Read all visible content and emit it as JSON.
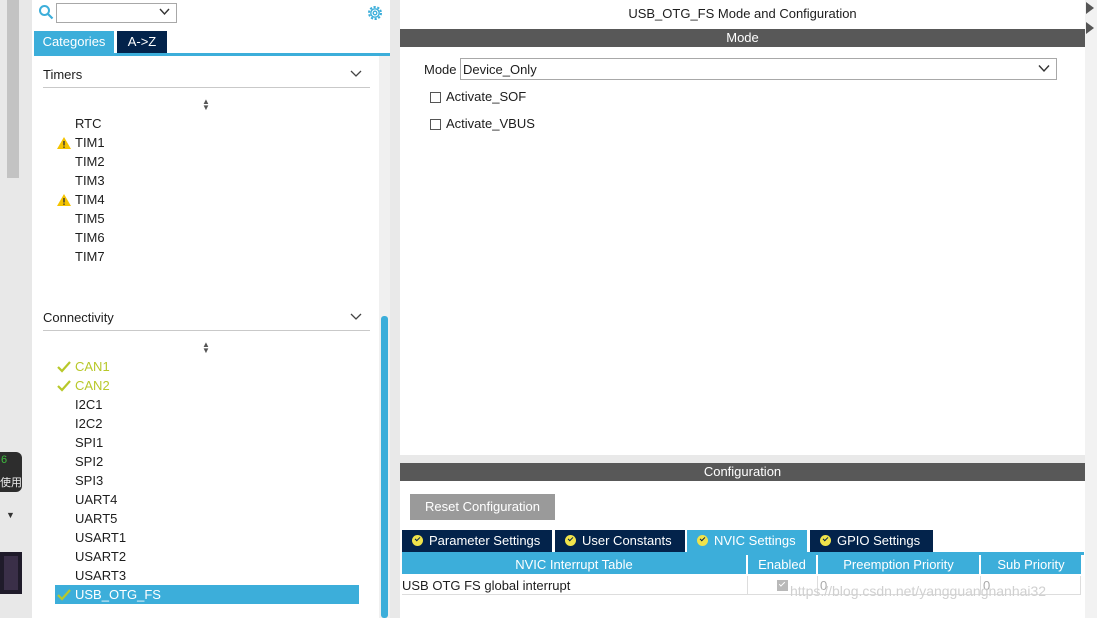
{
  "left_strip": {
    "popup_line1": "6",
    "popup_line2": "使用"
  },
  "left_panel": {
    "search_value": "",
    "tabs": [
      {
        "label": "Categories",
        "active": true
      },
      {
        "label": "A->Z",
        "active": false
      }
    ],
    "sections": [
      {
        "title": "Timers",
        "items": [
          {
            "label": "RTC",
            "status": "none"
          },
          {
            "label": "TIM1",
            "status": "warning"
          },
          {
            "label": "TIM2",
            "status": "none"
          },
          {
            "label": "TIM3",
            "status": "none"
          },
          {
            "label": "TIM4",
            "status": "warning"
          },
          {
            "label": "TIM5",
            "status": "none"
          },
          {
            "label": "TIM6",
            "status": "none"
          },
          {
            "label": "TIM7",
            "status": "none"
          }
        ]
      },
      {
        "title": "Connectivity",
        "items": [
          {
            "label": "CAN1",
            "status": "ok"
          },
          {
            "label": "CAN2",
            "status": "ok"
          },
          {
            "label": "I2C1",
            "status": "none"
          },
          {
            "label": "I2C2",
            "status": "none"
          },
          {
            "label": "SPI1",
            "status": "none"
          },
          {
            "label": "SPI2",
            "status": "none"
          },
          {
            "label": "SPI3",
            "status": "none"
          },
          {
            "label": "UART4",
            "status": "none"
          },
          {
            "label": "UART5",
            "status": "none"
          },
          {
            "label": "USART1",
            "status": "none"
          },
          {
            "label": "USART2",
            "status": "none"
          },
          {
            "label": "USART3",
            "status": "none"
          },
          {
            "label": "USB_OTG_FS",
            "status": "ok",
            "selected": true
          }
        ]
      }
    ]
  },
  "right_panel": {
    "title": "USB_OTG_FS Mode and Configuration",
    "mode_header": "Mode",
    "mode_label": "Mode",
    "mode_value": "Device_Only",
    "checkboxes": [
      {
        "label": "Activate_SOF",
        "checked": false
      },
      {
        "label": "Activate_VBUS",
        "checked": false
      }
    ],
    "config_header": "Configuration",
    "reset_button": "Reset Configuration",
    "settings_tabs": [
      {
        "label": "Parameter Settings",
        "active": false
      },
      {
        "label": "User Constants",
        "active": false
      },
      {
        "label": "NVIC Settings",
        "active": true
      },
      {
        "label": "GPIO Settings",
        "active": false
      }
    ],
    "nvic_table": {
      "columns": [
        "NVIC Interrupt Table",
        "Enabled",
        "Preemption Priority",
        "Sub Priority"
      ],
      "rows": [
        {
          "name": "USB OTG FS global interrupt",
          "enabled": true,
          "preemption": "0",
          "sub": "0"
        }
      ]
    },
    "watermark": "https://blog.csdn.net/yangguangnanhai32"
  },
  "colors": {
    "accent": "#3caeda",
    "dark_tab": "#03234b",
    "bar": "#585858",
    "ok": "#b8c82a",
    "warning": "#f5c400"
  }
}
